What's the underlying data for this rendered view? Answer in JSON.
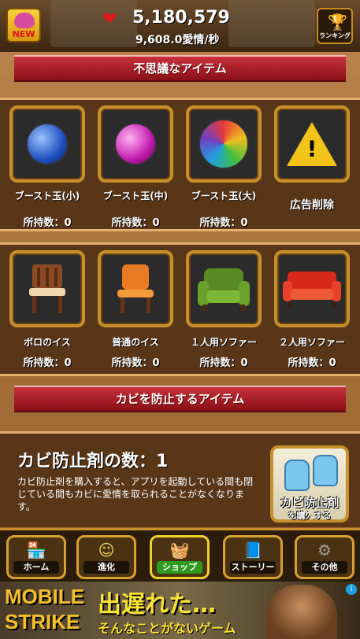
{
  "header": {
    "new_badge": "NEW",
    "love_total": "5,180,579",
    "love_rate": "9,608.0愛情/秒",
    "ranking_label": "ランキング"
  },
  "sections": {
    "mystery_title": "不思議なアイテム",
    "mold_title": "カビを防止するアイテム"
  },
  "items_row1": [
    {
      "name": "ブースト玉(小)",
      "count": "所持数：0",
      "icon": "blue-gem-icon"
    },
    {
      "name": "ブースト玉(中)",
      "count": "所持数：0",
      "icon": "purple-gem-icon"
    },
    {
      "name": "ブースト玉(大)",
      "count": "所持数：0",
      "icon": "rainbow-gem-icon"
    },
    {
      "name": "広告削除",
      "icon": "warning-icon"
    }
  ],
  "items_row2": [
    {
      "name": "ボロのイス",
      "count": "所持数：0",
      "icon": "wooden-chair-icon"
    },
    {
      "name": "普通のイス",
      "count": "所持数：0",
      "icon": "orange-chair-icon"
    },
    {
      "name": "１人用ソファー",
      "count": "所持数：0",
      "icon": "green-sofa-icon"
    },
    {
      "name": "２人用ソファー",
      "count": "所持数：0",
      "icon": "red-sofa-icon"
    }
  ],
  "mold": {
    "title": "カビ防止剤の数：1",
    "description": "カビ防止剤を購入すると、アプリを起動している間も閉じている間もカビに愛情を取られることがなくなります。",
    "buy_line1": "カビ防止剤",
    "buy_line2": "を購入する"
  },
  "nav": [
    {
      "label": "ホーム",
      "icon": "shop-front-icon"
    },
    {
      "label": "進化",
      "icon": "character-icon"
    },
    {
      "label": "ショップ",
      "icon": "shopping-basket-icon",
      "active": true
    },
    {
      "label": "ストーリー",
      "icon": "story-book-icon"
    },
    {
      "label": "その他",
      "icon": "gears-icon"
    }
  ],
  "ad": {
    "brand_line1": "MOBILE",
    "brand_line2": "STRIKE",
    "headline": "出遅れた…",
    "subline": "そんなことがないゲーム"
  },
  "colors": {
    "ribbon": "#b01c28",
    "frame_gold": "#c8902c",
    "active_nav": "#2e9a1e"
  }
}
